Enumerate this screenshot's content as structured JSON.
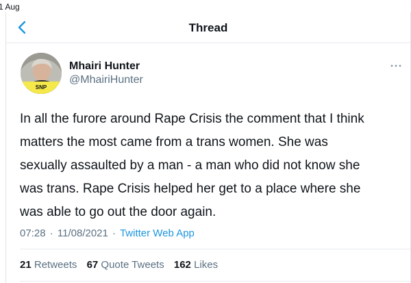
{
  "top_fragment": "1 Aug",
  "header": {
    "title": "Thread",
    "back_icon": "chevron-left-icon",
    "accent_color": "#1b95e0"
  },
  "tweet": {
    "author_name": "Mhairi Hunter",
    "author_handle": "@MhairiHunter",
    "avatar_badge": "SNP",
    "more_icon": "more-horizontal-icon",
    "text": "In all the furore around Rape Crisis the comment that I think\nmatters the most came from a trans women.  She was\nsexually assaulted by a man - a man who did not know she\nwas trans. Rape Crisis helped her get to a place where she\nwas able to go out the door again.",
    "time": "07:28",
    "date": "11/08/2021",
    "separator1": "·",
    "separator2": "·",
    "source": "Twitter Web App"
  },
  "stats": {
    "retweets_count": "21",
    "retweets_label": "Retweets",
    "quotes_count": "67",
    "quotes_label": "Quote Tweets",
    "likes_count": "162",
    "likes_label": "Likes"
  }
}
